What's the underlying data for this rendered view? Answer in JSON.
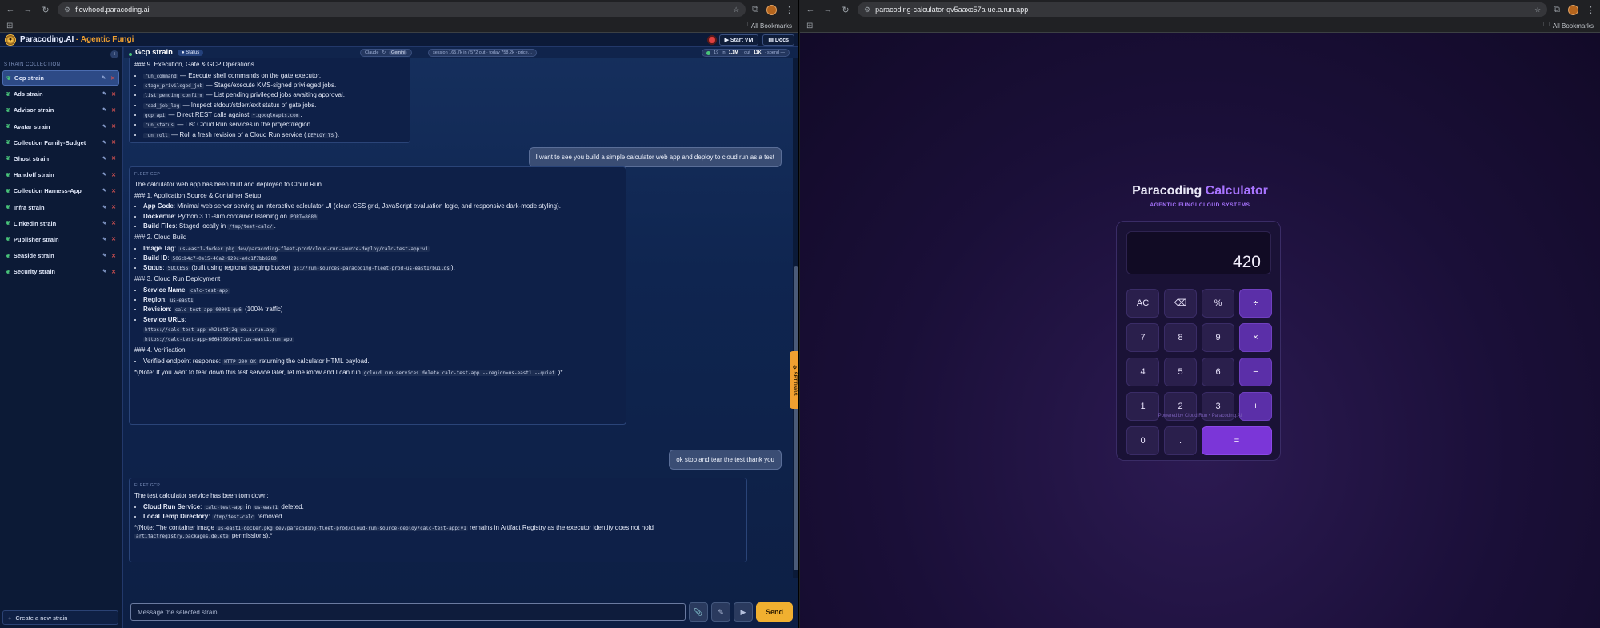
{
  "left_browser": {
    "url": "flowhood.paracoding.ai",
    "bookmarks_label": "All Bookmarks"
  },
  "right_browser": {
    "url": "paracoding-calculator-qv5aaxc57a-ue.a.run.app",
    "bookmarks_label": "All Bookmarks"
  },
  "app": {
    "title_main": "Paracoding.AI",
    "title_sub": " - Agentic Fungi",
    "start_vm_label": "Start VM",
    "docs_label": "Docs"
  },
  "sidebar": {
    "section_label": "STRAIN COLLECTION",
    "items": [
      {
        "label": "Gcp strain"
      },
      {
        "label": "Ads strain"
      },
      {
        "label": "Advisor strain"
      },
      {
        "label": "Avatar strain"
      },
      {
        "label": "Collection Family-Budget"
      },
      {
        "label": "Ghost strain"
      },
      {
        "label": "Handoff strain"
      },
      {
        "label": "Collection Harness-App"
      },
      {
        "label": "Infra strain"
      },
      {
        "label": "Linkedin strain"
      },
      {
        "label": "Publisher strain"
      },
      {
        "label": "Seaside strain"
      },
      {
        "label": "Security strain"
      }
    ],
    "new_strain_label": "Create a new strain"
  },
  "strain_header": {
    "name": "Gcp strain",
    "status_label": "Status",
    "model_left": "Claude",
    "model_sep": "↻",
    "model_right": "Gemini",
    "session_info": "session 165.7k in / 572 out · today 758.2k · price…",
    "usage_count": "19",
    "usage_in": "1.1M",
    "usage_out": "11K",
    "usage_text_a": "in",
    "usage_text_b": "· out",
    "usage_text_c": "· spend —"
  },
  "chat": {
    "msg1": {
      "heading": "### 9. Execution, Gate & GCP Operations",
      "items": [
        {
          "code": "run_command",
          "text": " — Execute shell commands on the gate executor."
        },
        {
          "code": "stage_privileged_job",
          "text": " — Stage/execute KMS-signed privileged jobs."
        },
        {
          "code": "list_pending_confirm",
          "text": " — List pending privileged jobs awaiting approval."
        },
        {
          "code": "read_job_log",
          "text": " — Inspect stdout/stderr/exit status of gate jobs."
        },
        {
          "code": "gcp_api",
          "text": " — Direct REST calls against ",
          "code2": "*.googleapis.com",
          "text2": "."
        },
        {
          "code": "run_status",
          "text": " — List Cloud Run services in the project/region."
        },
        {
          "code": "run_roll",
          "text": " — Roll a fresh revision of a Cloud Run service (",
          "code2": "DEPLOY_TS",
          "text2": ")."
        }
      ]
    },
    "user1": "I want to see you build a simple calculator web app and deploy to cloud run as a test",
    "msg2": {
      "who": "FLEET GCP",
      "intro": "The calculator web app has been built and deployed to Cloud Run.",
      "h1": "### 1. Application Source & Container Setup",
      "app_code_label": "App Code",
      "app_code_text": ": Minimal web server serving an interactive calculator UI (clean CSS grid, JavaScript evaluation logic, and responsive dark-mode styling).",
      "dockerfile_label": "Dockerfile",
      "dockerfile_text": ": Python 3.11-slim container listening on ",
      "dockerfile_code": "PORT=8080",
      "build_files_label": "Build Files",
      "build_files_text": ": Staged locally in ",
      "build_files_code": "/tmp/test-calc/",
      "h2": "### 2. Cloud Build",
      "image_tag_label": "Image Tag",
      "image_tag_code": "us-east1-docker.pkg.dev/paracoding-fleet-prod/cloud-run-source-deploy/calc-test-app:v1",
      "build_id_label": "Build ID",
      "build_id_code": "506cb4c7-0e15-40a2-929c-e0c1f7bb8280",
      "status_label": "Status",
      "status_code": "SUCCESS",
      "status_text": " (built using regional staging bucket ",
      "status_code2": "gs://run-sources-paracoding-fleet-prod-us-east1/builds",
      "h3": "### 3. Cloud Run Deployment",
      "service_name_label": "Service Name",
      "service_name_code": "calc-test-app",
      "region_label": "Region",
      "region_code": "us-east1",
      "revision_label": "Revision",
      "revision_code": "calc-test-app-00001-qw6",
      "revision_text": " (100% traffic)",
      "service_urls_label": "Service URLs",
      "url1": "https://calc-test-app-eh21st3j2q-ue.a.run.app",
      "url2": "https://calc-test-app-666479038487.us-east1.run.app",
      "h4": "### 4. Verification",
      "verify_text": "Verified endpoint response: ",
      "verify_code": "HTTP 200 OK",
      "verify_text2": " returning the calculator HTML payload.",
      "note_text": "*(Note: If you want to tear down this test service later, let me know and I can run ",
      "note_code": "gcloud run services delete calc-test-app --region=us-east1 --quiet",
      "note_end": ".)*"
    },
    "user2": "ok stop and tear the test thank you",
    "msg3": {
      "who": "FLEET GCP",
      "intro": "The test calculator service has been torn down:",
      "crs_label": "Cloud Run Service",
      "crs_code": "calc-test-app",
      "crs_in": " in ",
      "crs_code2": "us-east1",
      "crs_end": " deleted.",
      "ltd_label": "Local Temp Directory",
      "ltd_code": "/tmp/test-calc",
      "ltd_end": " removed.",
      "note_text": "*(Note: The container image ",
      "note_code": "us-east1-docker.pkg.dev/paracoding-fleet-prod/cloud-run-source-deploy/calc-test-app:v1",
      "note_text2": " remains in Artifact Registry as the executor identity does not hold ",
      "note_code2": "artifactregistry.packages.delete",
      "note_end": " permissions).*"
    }
  },
  "composer": {
    "placeholder": "Message the selected strain...",
    "send_label": "Send"
  },
  "settings_tab_label": "⚙ SETTINGS",
  "calculator": {
    "title_a": "Paracoding ",
    "title_b": "Calculator",
    "subtitle": "AGENTIC FUNGI CLOUD SYSTEMS",
    "display": "420",
    "keys": [
      {
        "label": "AC"
      },
      {
        "label": "⌫"
      },
      {
        "label": "%"
      },
      {
        "label": "÷"
      },
      {
        "label": "7"
      },
      {
        "label": "8"
      },
      {
        "label": "9"
      },
      {
        "label": "×"
      },
      {
        "label": "4"
      },
      {
        "label": "5"
      },
      {
        "label": "6"
      },
      {
        "label": "−"
      },
      {
        "label": "1"
      },
      {
        "label": "2"
      },
      {
        "label": "3"
      },
      {
        "label": "+"
      },
      {
        "label": "0"
      },
      {
        "label": "."
      },
      {
        "label": "="
      }
    ],
    "footer": "Powered by Cloud Run • Paracoding.AI"
  }
}
